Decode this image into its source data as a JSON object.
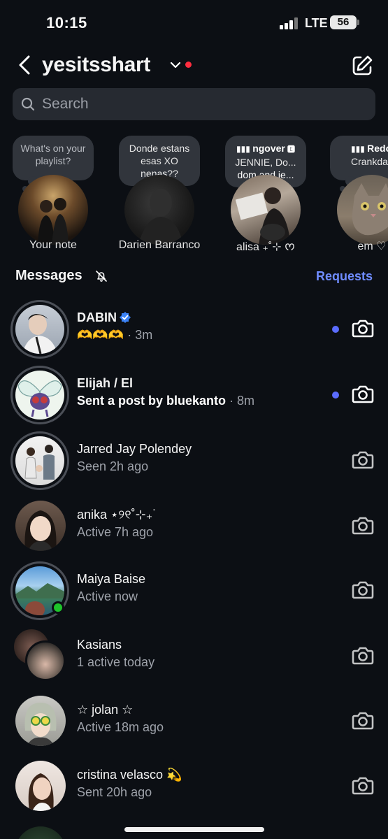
{
  "status_bar": {
    "time": "10:15",
    "network": "LTE",
    "battery": "56"
  },
  "header": {
    "username": "yesitsshart"
  },
  "search": {
    "placeholder": "Search"
  },
  "notes": [
    {
      "text": "What's on your playlist?",
      "name": "Your note"
    },
    {
      "text": "Donde estans esas XO nenas??",
      "name": "Darien Barranco"
    },
    {
      "song": "ngover",
      "artist_line": "JENNIE, Do...",
      "line3": "dom and je...",
      "name": "alisa ₊˚⊹ ᰔ"
    },
    {
      "song": "Redo",
      "artist_line": "Crankda",
      "name": "em ♡"
    }
  ],
  "messages_section": {
    "title": "Messages",
    "requests_label": "Requests"
  },
  "conversations": [
    {
      "name": "DABIN",
      "preview": "🫶🫶🫶",
      "time": "· 3m",
      "unread": true
    },
    {
      "name": "Elijah / El",
      "preview": "Sent a post by bluekanto",
      "time": "· 8m",
      "unread": true
    },
    {
      "name": "Jarred Jay Polendey",
      "preview": "Seen 2h ago",
      "unread": false
    },
    {
      "name": "anika ⋆୨୧˚⊹₊˙",
      "preview": "Active 7h ago",
      "unread": false
    },
    {
      "name": "Maiya Baise",
      "preview": "Active now",
      "unread": false
    },
    {
      "name": "Kasians",
      "preview": "1 active today",
      "unread": false
    },
    {
      "name": "☆ jolan ☆",
      "preview": "Active 18m ago",
      "unread": false
    },
    {
      "name": "cristina velasco 💫",
      "preview": "Sent 20h ago",
      "unread": false
    }
  ],
  "colors": {
    "accent": "#6f8cff",
    "unread_dot": "#5b6cff",
    "online": "#1ec52b",
    "notification": "#ff2d3f"
  }
}
